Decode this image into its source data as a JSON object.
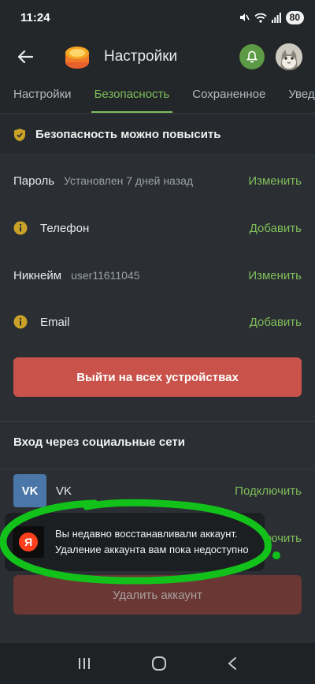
{
  "status": {
    "time": "11:24",
    "battery": "80"
  },
  "appbar": {
    "title": "Настройки"
  },
  "tabs": [
    {
      "label": "Настройки",
      "active": false
    },
    {
      "label": "Безопасность",
      "active": true
    },
    {
      "label": "Сохраненное",
      "active": false
    },
    {
      "label": "Уведо",
      "active": false
    }
  ],
  "banner": {
    "text": "Безопасность можно повысить"
  },
  "rows": {
    "password": {
      "label": "Пароль",
      "value": "Установлен 7 дней назад",
      "action": "Изменить"
    },
    "phone": {
      "label": "Телефон",
      "action": "Добавить"
    },
    "nickname": {
      "label": "Никнейм",
      "value": "user11611045",
      "action": "Изменить"
    },
    "email": {
      "label": "Email",
      "action": "Добавить"
    }
  },
  "logout_button": "Выйти на всех устройствах",
  "social": {
    "title": "Вход через социальные сети",
    "vk": {
      "logo": "VK",
      "name": "VK",
      "action": "Подключить"
    },
    "yandex": {
      "logo": "Я",
      "action_partial": "ючить"
    }
  },
  "toast": {
    "line1": "Вы недавно восстанавливали аккаунт.",
    "line2": "Удаление аккаунта вам пока недоступно"
  },
  "delete_button": "Удалить аккаунт",
  "colors": {
    "accent": "#7fbd5a",
    "danger": "#c9534a",
    "annotation": "#12c21a"
  }
}
